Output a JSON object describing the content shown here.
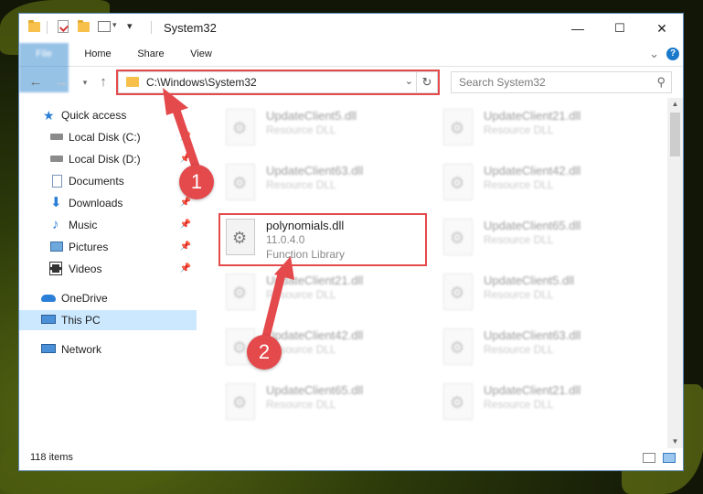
{
  "window": {
    "title": "System32",
    "minimize": "—",
    "maximize": "☐",
    "close": "✕"
  },
  "ribbon": {
    "tabs": [
      "File",
      "Home",
      "Share",
      "View"
    ],
    "collapse": "⌄",
    "help": "?"
  },
  "address": {
    "path": "C:\\Windows\\System32",
    "search_placeholder": "Search System32"
  },
  "nav": {
    "items": [
      {
        "label": "Quick access"
      },
      {
        "label": "Local Disk (C:)"
      },
      {
        "label": "Local Disk (D:)"
      },
      {
        "label": "Documents"
      },
      {
        "label": "Downloads"
      },
      {
        "label": "Music"
      },
      {
        "label": "Pictures"
      },
      {
        "label": "Videos"
      },
      {
        "label": "OneDrive"
      },
      {
        "label": "This PC"
      },
      {
        "label": "Network"
      }
    ]
  },
  "files": {
    "left": [
      {
        "name": "UpdateClient5.dll",
        "line1": "Resource DLL"
      },
      {
        "name": "UpdateClient63.dll",
        "line1": "Resource DLL"
      },
      {
        "name": "polynomials.dll",
        "line1": "11.0.4.0",
        "line2": "Function Library"
      },
      {
        "name": "UpdateClient21.dll",
        "line1": "Resource DLL"
      },
      {
        "name": "UpdateClient42.dll",
        "line1": "Resource DLL"
      },
      {
        "name": "UpdateClient65.dll",
        "line1": "Resource DLL"
      }
    ],
    "right": [
      {
        "name": "UpdateClient21.dll",
        "line1": "Resource DLL"
      },
      {
        "name": "UpdateClient42.dll",
        "line1": "Resource DLL"
      },
      {
        "name": "UpdateClient65.dll",
        "line1": "Resource DLL"
      },
      {
        "name": "UpdateClient5.dll",
        "line1": "Resource DLL"
      },
      {
        "name": "UpdateClient63.dll",
        "line1": "Resource DLL"
      },
      {
        "name": "UpdateClient21.dll",
        "line1": "Resource DLL"
      }
    ]
  },
  "status": {
    "items": "118 items"
  },
  "callouts": {
    "one": "1",
    "two": "2"
  },
  "colors": {
    "accent": "#1979ca",
    "highlight": "#e4494c",
    "selected": "#cce8ff"
  }
}
